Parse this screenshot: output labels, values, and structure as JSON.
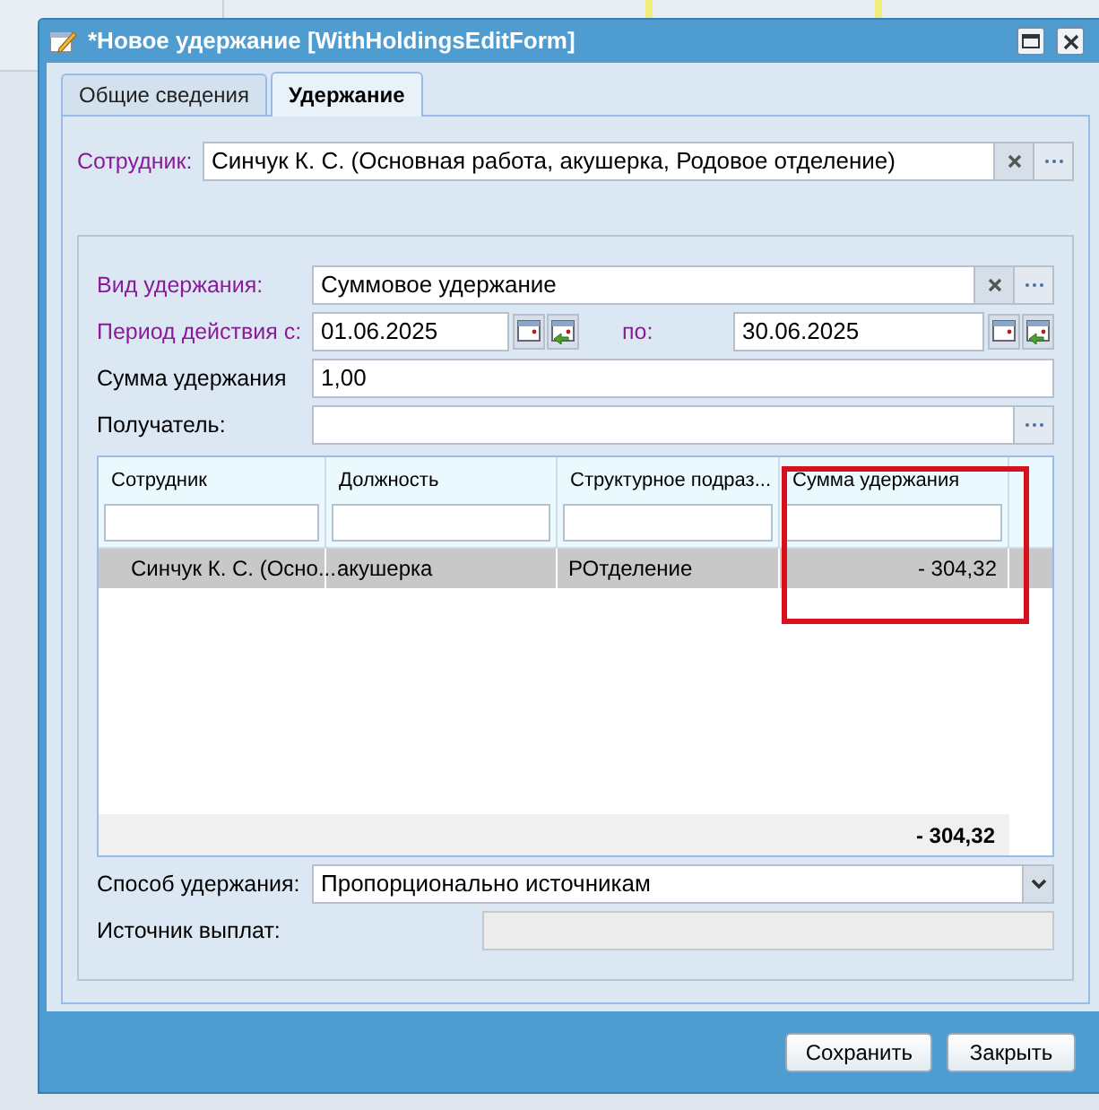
{
  "window": {
    "title": "*Новое удержание [WithHoldingsEditForm]"
  },
  "tabs": [
    {
      "label": "Общие сведения",
      "selected": false
    },
    {
      "label": "Удержание",
      "selected": true
    }
  ],
  "employee": {
    "label": "Сотрудник:",
    "required": true,
    "value": "Синчук К. С. (Основная работа, акушерка, Родовое отделение)"
  },
  "withholding_type": {
    "label": "Вид удержания:",
    "required": true,
    "value": "Суммовое удержание"
  },
  "period": {
    "label": "Период действия с:",
    "required": true,
    "from": "01.06.2025",
    "to_label": "по:",
    "to": "30.06.2025"
  },
  "amount": {
    "label": "Сумма удержания",
    "required": false,
    "value": "1,00"
  },
  "recipient": {
    "label": "Получатель:",
    "required": false
  },
  "grid": {
    "columns": [
      {
        "label": "Сотрудник",
        "highlighted": false
      },
      {
        "label": "Должность",
        "highlighted": false
      },
      {
        "label": "Структурное подраз...",
        "highlighted": false
      },
      {
        "label": "Сумма удержания",
        "highlighted": true
      }
    ],
    "rows": [
      {
        "selected": true,
        "cells": [
          "Синчук К. С. (Осно...",
          "акушерка",
          "РОтделение",
          "- 304,32"
        ]
      }
    ],
    "total": "- 304,32"
  },
  "method": {
    "label": "Способ удержания:",
    "value": "Пропорционально источникам"
  },
  "source": {
    "label": "Источник выплат:",
    "disabled": true
  },
  "buttons": [
    "Сохранить",
    "Закрыть"
  ]
}
